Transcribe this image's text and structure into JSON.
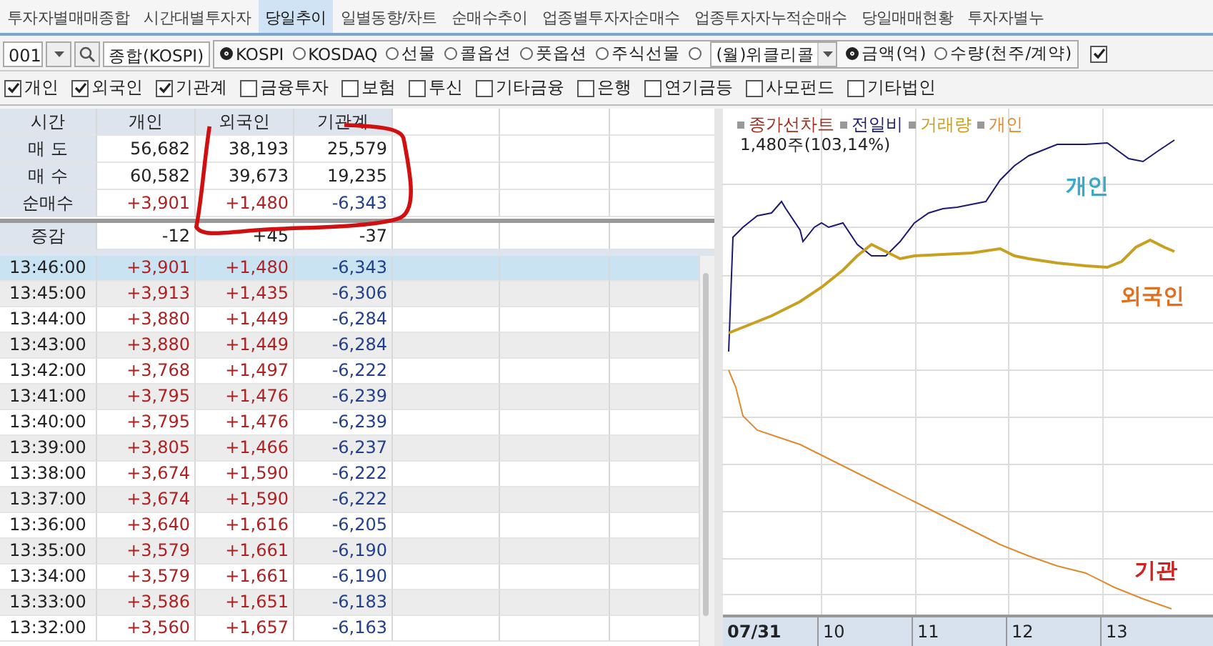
{
  "tabs": [
    {
      "label": "투자자별매매종합",
      "selected": false
    },
    {
      "label": "시간대별투자자",
      "selected": false
    },
    {
      "label": "당일추이",
      "selected": true
    },
    {
      "label": "일별동향/차트",
      "selected": false
    },
    {
      "label": "순매수추이",
      "selected": false
    },
    {
      "label": "업종별투자자순매수",
      "selected": false
    },
    {
      "label": "업종투자자누적순매수",
      "selected": false
    },
    {
      "label": "당일매매현황",
      "selected": false
    },
    {
      "label": "투자자별누",
      "selected": false
    }
  ],
  "toolbar": {
    "code_field": {
      "value": "001"
    },
    "name_field": {
      "value": "종합(KOSPI)"
    },
    "markets": [
      {
        "label": "KOSPI",
        "selected": true
      },
      {
        "label": "KOSDAQ",
        "selected": false
      },
      {
        "label": "선물",
        "selected": false
      },
      {
        "label": "콜옵션",
        "selected": false
      },
      {
        "label": "풋옵션",
        "selected": false
      },
      {
        "label": "주식선물",
        "selected": false
      }
    ],
    "weekly_radio": {
      "selected": false
    },
    "weekly_dropdown": {
      "value": "(월)위클리콜"
    },
    "units": [
      {
        "label": "금액(억)",
        "selected": true
      },
      {
        "label": "수량(천주/계약)",
        "selected": false
      }
    ],
    "extra_checkbox": {
      "checked": true
    }
  },
  "filters": [
    {
      "label": "개인",
      "checked": true
    },
    {
      "label": "외국인",
      "checked": true
    },
    {
      "label": "기관계",
      "checked": true
    },
    {
      "label": "금융투자",
      "checked": false
    },
    {
      "label": "보험",
      "checked": false
    },
    {
      "label": "투신",
      "checked": false
    },
    {
      "label": "기타금융",
      "checked": false
    },
    {
      "label": "은행",
      "checked": false
    },
    {
      "label": "연기금등",
      "checked": false
    },
    {
      "label": "사모펀드",
      "checked": false
    },
    {
      "label": "기타법인",
      "checked": false
    }
  ],
  "summary": {
    "columns": [
      "시간",
      "개인",
      "외국인",
      "기관계"
    ],
    "rows": [
      {
        "label": "매 도",
        "values": [
          "56,682",
          "38,193",
          "25,579"
        ]
      },
      {
        "label": "매 수",
        "values": [
          "60,582",
          "39,673",
          "19,235"
        ]
      },
      {
        "label": "순매수",
        "values": [
          "+3,901",
          "+1,480",
          "-6,343"
        ]
      },
      {
        "label": "증감",
        "values": [
          "-12",
          "+45",
          "-37"
        ]
      }
    ]
  },
  "minute_table": {
    "rows": [
      {
        "time": "13:46:00",
        "values": [
          "+3,901",
          "+1,480",
          "-6,343"
        ],
        "selected": true
      },
      {
        "time": "13:45:00",
        "values": [
          "+3,913",
          "+1,435",
          "-6,306"
        ],
        "selected": false
      },
      {
        "time": "13:44:00",
        "values": [
          "+3,880",
          "+1,449",
          "-6,284"
        ],
        "selected": false
      },
      {
        "time": "13:43:00",
        "values": [
          "+3,880",
          "+1,449",
          "-6,284"
        ],
        "selected": false
      },
      {
        "time": "13:42:00",
        "values": [
          "+3,768",
          "+1,497",
          "-6,222"
        ],
        "selected": false
      },
      {
        "time": "13:41:00",
        "values": [
          "+3,795",
          "+1,476",
          "-6,239"
        ],
        "selected": false
      },
      {
        "time": "13:40:00",
        "values": [
          "+3,795",
          "+1,476",
          "-6,239"
        ],
        "selected": false
      },
      {
        "time": "13:39:00",
        "values": [
          "+3,805",
          "+1,466",
          "-6,237"
        ],
        "selected": false
      },
      {
        "time": "13:38:00",
        "values": [
          "+3,674",
          "+1,590",
          "-6,222"
        ],
        "selected": false
      },
      {
        "time": "13:37:00",
        "values": [
          "+3,674",
          "+1,590",
          "-6,222"
        ],
        "selected": false
      },
      {
        "time": "13:36:00",
        "values": [
          "+3,640",
          "+1,616",
          "-6,205"
        ],
        "selected": false
      },
      {
        "time": "13:35:00",
        "values": [
          "+3,579",
          "+1,661",
          "-6,190"
        ],
        "selected": false
      },
      {
        "time": "13:34:00",
        "values": [
          "+3,579",
          "+1,661",
          "-6,190"
        ],
        "selected": false
      },
      {
        "time": "13:33:00",
        "values": [
          "+3,586",
          "+1,651",
          "-6,183"
        ],
        "selected": false
      },
      {
        "time": "13:32:00",
        "values": [
          "+3,560",
          "+1,657",
          "-6,163"
        ],
        "selected": false
      }
    ]
  },
  "chart": {
    "legend": [
      {
        "label": "종가선차트",
        "color": "#a03020"
      },
      {
        "label": "전일비",
        "color": "#1a1a70"
      },
      {
        "label": "거래량",
        "color": "#c8a020"
      },
      {
        "label": "개인",
        "color": "#e08a30"
      }
    ],
    "reading": "1,480주(103,14%)",
    "series_labels": [
      {
        "label": "개인",
        "color": "#3aa9c9"
      },
      {
        "label": "외국인",
        "color": "#e07020"
      },
      {
        "label": "기관",
        "color": "#d02020"
      }
    ],
    "x_labels": [
      "07/31",
      "10",
      "11",
      "12",
      "13"
    ]
  }
}
